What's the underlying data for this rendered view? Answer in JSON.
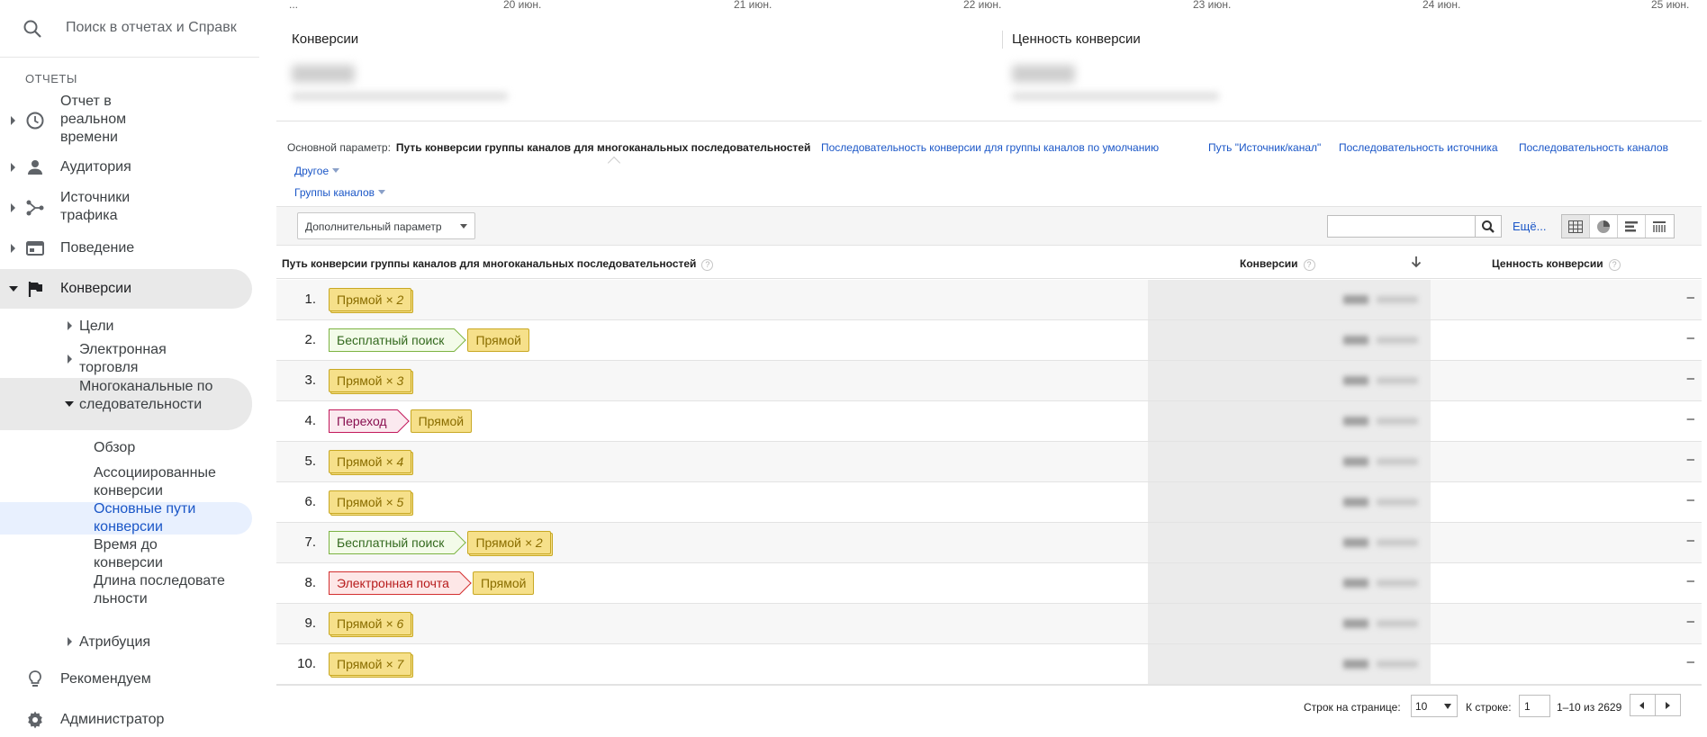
{
  "sidebar": {
    "search_placeholder": "Поиск в отчетах и Справк",
    "section_label": "ОТЧЕТЫ",
    "nav": [
      {
        "label": "Отчет в реальном времени",
        "icon": "clock-icon"
      },
      {
        "label": "Аудитория",
        "icon": "person-icon"
      },
      {
        "label": "Источники трафика",
        "icon": "acquisition-icon"
      },
      {
        "label": "Поведение",
        "icon": "behavior-icon"
      },
      {
        "label": "Конверсии",
        "icon": "flag-icon"
      }
    ],
    "conversions_children": [
      {
        "label": "Цели"
      },
      {
        "label": "Электронная торговля"
      },
      {
        "label": "Многоканальные последовательности"
      }
    ],
    "mcf_children": [
      {
        "label": "Обзор"
      },
      {
        "label": "Ассоциированные конверсии"
      },
      {
        "label": "Основные пути конверсии"
      },
      {
        "label": "Время до конверсии"
      },
      {
        "label": "Длина последовательности"
      }
    ],
    "attribution": "Атрибуция",
    "footer": [
      {
        "label": "Рекомендуем",
        "icon": "lightbulb-icon"
      },
      {
        "label": "Администратор",
        "icon": "gear-icon"
      }
    ]
  },
  "axis_dates": [
    "...",
    "20 июн.",
    "21 июн.",
    "22 июн.",
    "23 июн.",
    "24 июн.",
    "25 июн."
  ],
  "kpis": [
    {
      "title": "Конверсии"
    },
    {
      "title": "Ценность конверсии"
    }
  ],
  "primary_dimension": {
    "label": "Основной параметр:",
    "active": "Путь конверсии группы каналов для многоканальных последовательностей",
    "links": [
      "Последовательность конверсии для группы каналов по умолчанию",
      "Путь \"Источник/канал\"",
      "Последовательность источника",
      "Последовательность каналов"
    ],
    "other": "Другое",
    "channel_groups": "Группы каналов"
  },
  "toolbar": {
    "secondary_dimension": "Дополнительный параметр",
    "more": "Ещё..."
  },
  "table": {
    "columns": {
      "path": "Путь конверсии группы каналов для многоканальных последовательностей",
      "conversions": "Конверсии",
      "value": "Ценность конверсии"
    },
    "help_glyph": "?",
    "rows": [
      {
        "num": "1.",
        "value": "–",
        "tags": [
          {
            "text": "Прямой",
            "mult": "× 2",
            "type": "direct"
          }
        ]
      },
      {
        "num": "2.",
        "value": "–",
        "tags": [
          {
            "text": "Бесплатный поиск",
            "mult": "",
            "type": "organic"
          },
          {
            "text": "Прямой",
            "mult": "",
            "type": "direct"
          }
        ]
      },
      {
        "num": "3.",
        "value": "–",
        "tags": [
          {
            "text": "Прямой",
            "mult": "× 3",
            "type": "direct"
          }
        ]
      },
      {
        "num": "4.",
        "value": "–",
        "tags": [
          {
            "text": "Переход",
            "mult": "",
            "type": "referral"
          },
          {
            "text": "Прямой",
            "mult": "",
            "type": "direct"
          }
        ]
      },
      {
        "num": "5.",
        "value": "–",
        "tags": [
          {
            "text": "Прямой",
            "mult": "× 4",
            "type": "direct"
          }
        ]
      },
      {
        "num": "6.",
        "value": "–",
        "tags": [
          {
            "text": "Прямой",
            "mult": "× 5",
            "type": "direct"
          }
        ]
      },
      {
        "num": "7.",
        "value": "–",
        "tags": [
          {
            "text": "Бесплатный поиск",
            "mult": "",
            "type": "organic"
          },
          {
            "text": "Прямой",
            "mult": "× 2",
            "type": "direct"
          }
        ]
      },
      {
        "num": "8.",
        "value": "–",
        "tags": [
          {
            "text": "Электронная почта",
            "mult": "",
            "type": "email"
          },
          {
            "text": "Прямой",
            "mult": "",
            "type": "direct"
          }
        ]
      },
      {
        "num": "9.",
        "value": "–",
        "tags": [
          {
            "text": "Прямой",
            "mult": "× 6",
            "type": "direct"
          }
        ]
      },
      {
        "num": "10.",
        "value": "–",
        "tags": [
          {
            "text": "Прямой",
            "mult": "× 7",
            "type": "direct"
          }
        ]
      }
    ]
  },
  "pager": {
    "rows_per_page_label": "Строк на странице:",
    "rows_per_page": "10",
    "goto_label": "К строке:",
    "goto_value": "1",
    "range": "1–10 из 2629"
  },
  "colors": {
    "link": "#1a56c7",
    "direct_bg": "#f6e08a",
    "organic_border": "#7cb342",
    "referral_border": "#c2185b",
    "email_border": "#d32f2f"
  }
}
